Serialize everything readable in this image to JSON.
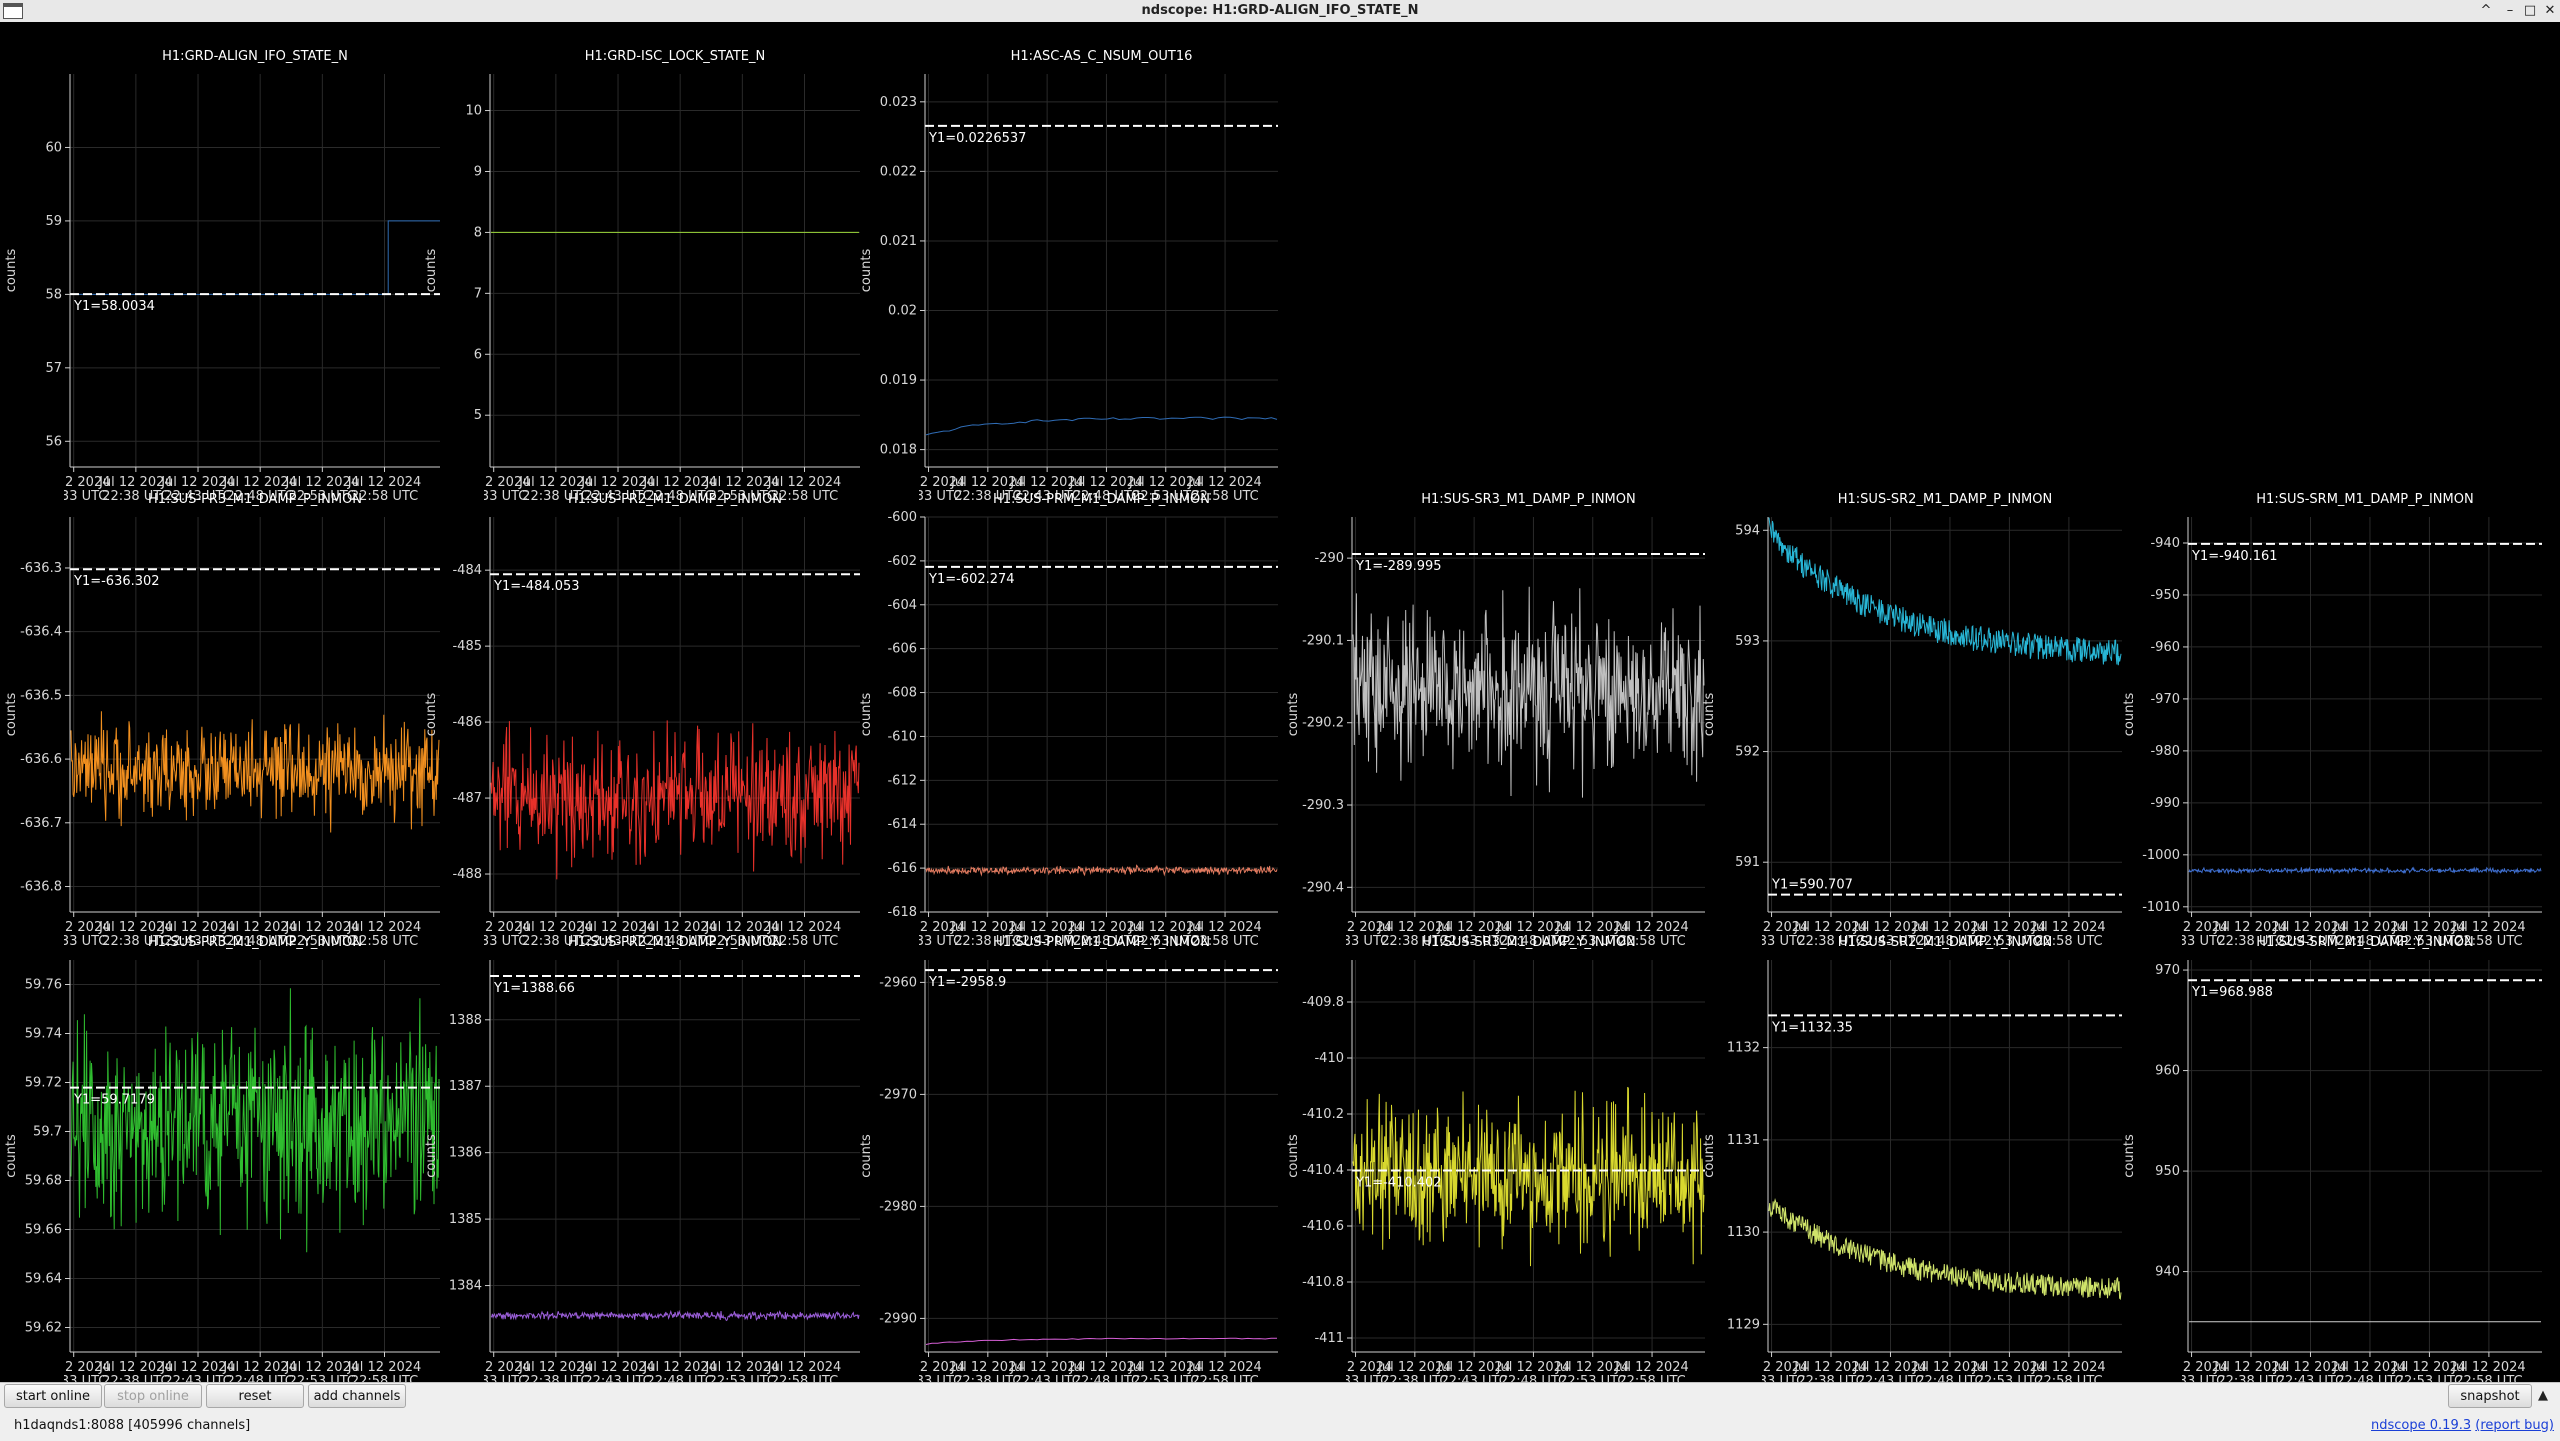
{
  "window": {
    "title": "ndscope: H1:GRD-ALIGN_IFO_STATE_N",
    "controls": [
      "^",
      "–",
      "□",
      "✕"
    ]
  },
  "common": {
    "y_axis_label": "counts",
    "x_ticks": [
      "Jul 12 2024\n22:33 UTC",
      "Jul 12 2024\n22:38 UTC",
      "Jul 12 2024\n22:43 UTC",
      "Jul 12 2024\n22:48 UTC",
      "Jul 12 2024\n22:53 UTC",
      "Jul 12 2024\n22:58 UTC"
    ]
  },
  "plots": [
    {
      "channel": "H1:GRD-ALIGN_IFO_STATE_N",
      "color": "#2f6cb5",
      "cursor_y": 58.0034,
      "cursor_label": "Y1=58.0034",
      "ylim": [
        55.65,
        61.0
      ],
      "yticks": [
        56,
        57,
        58,
        59,
        60
      ],
      "shape": {
        "kind": "step",
        "base": 58.0,
        "step_to": 59.0,
        "at": 0.86
      }
    },
    {
      "channel": "H1:GRD-ISC_LOCK_STATE_N",
      "color": "#9bd83a",
      "cursor_y": null,
      "cursor_label": "",
      "ylim": [
        4.15,
        10.6
      ],
      "yticks": [
        5,
        6,
        7,
        8,
        9,
        10
      ],
      "shape": {
        "kind": "flat",
        "base": 8.0
      }
    },
    {
      "channel": "H1:ASC-AS_C_NSUM_OUT16",
      "color": "#2f6cb5",
      "cursor_y": 0.0226537,
      "cursor_label": "Y1=0.0226537",
      "ylim": [
        0.01775,
        0.0234
      ],
      "yticks": [
        0.018,
        0.019,
        0.02,
        0.021,
        0.022,
        0.023
      ],
      "shape": {
        "kind": "rise",
        "start": 0.0182,
        "end": 0.01845
      }
    },
    {
      "channel": "H1:SUS-PR3_M1_DAMP_P_INMON",
      "color": "#f2901f",
      "cursor_y": -636.302,
      "cursor_label": "Y1=-636.302",
      "ylim": [
        -636.84,
        -636.22
      ],
      "yticks": [
        -636.8,
        -636.7,
        -636.6,
        -636.5,
        -636.4,
        -636.3
      ],
      "shape": {
        "kind": "noise",
        "center": -636.62,
        "amp": 0.05
      }
    },
    {
      "channel": "H1:SUS-PR2_M1_DAMP_P_INMON",
      "color": "#e8312a",
      "cursor_y": -484.053,
      "cursor_label": "Y1=-484.053",
      "ylim": [
        -488.5,
        -483.3
      ],
      "yticks": [
        -488,
        -487,
        -486,
        -485,
        -484
      ],
      "shape": {
        "kind": "noise",
        "center": -486.95,
        "amp": 0.6
      }
    },
    {
      "channel": "H1:SUS-PRM_M1_DAMP_P_INMON",
      "color": "#e07a5f",
      "cursor_y": -602.274,
      "cursor_label": "Y1=-602.274",
      "ylim": [
        -618.0,
        -600.0
      ],
      "yticks": [
        -618,
        -616,
        -614,
        -612,
        -610,
        -608,
        -606,
        -604,
        -602,
        -600
      ],
      "shape": {
        "kind": "noise",
        "center": -616.1,
        "amp": 0.12
      }
    },
    {
      "channel": "H1:SUS-SR3_M1_DAMP_P_INMON",
      "color": "#bfbfbf",
      "cursor_y": -289.995,
      "cursor_label": "Y1=-289.995",
      "ylim": [
        -290.43,
        -289.95
      ],
      "yticks": [
        -290.4,
        -290.3,
        -290.2,
        -290.1,
        -290.0
      ],
      "shape": {
        "kind": "noise",
        "center": -290.16,
        "amp": 0.07
      }
    },
    {
      "channel": "H1:SUS-SR2_M1_DAMP_P_INMON",
      "color": "#28b6d6",
      "cursor_y": 590.707,
      "cursor_label": "Y1=590.707",
      "ylim": [
        590.55,
        594.12
      ],
      "yticks": [
        591,
        592,
        593,
        594
      ],
      "shape": {
        "kind": "decay",
        "start": 594.0,
        "end": 592.85,
        "amp": 0.12
      }
    },
    {
      "channel": "H1:SUS-SRM_M1_DAMP_P_INMON",
      "color": "#3f6fd0",
      "cursor_y": -940.161,
      "cursor_label": "Y1=-940.161",
      "ylim": [
        -1011.0,
        -935.0
      ],
      "yticks": [
        -1010,
        -1000,
        -990,
        -980,
        -970,
        -960,
        -950,
        -940
      ],
      "shape": {
        "kind": "noise",
        "center": -1003.0,
        "amp": 0.3
      }
    },
    {
      "channel": "H1:SUS-PR3_M1_DAMP_Y_INMON",
      "color": "#2fbd2f",
      "cursor_y": 59.7179,
      "cursor_label": "Y1=59.7179",
      "ylim": [
        59.61,
        59.77
      ],
      "yticks": [
        59.62,
        59.64,
        59.66,
        59.68,
        59.7,
        59.72,
        59.74,
        59.76
      ],
      "shape": {
        "kind": "noise",
        "center": 59.705,
        "amp": 0.03
      }
    },
    {
      "channel": "H1:SUS-PR2_M1_DAMP_Y_INMON",
      "color": "#9a5ed8",
      "cursor_y": 1388.66,
      "cursor_label": "Y1=1388.66",
      "ylim": [
        1383.0,
        1388.9
      ],
      "yticks": [
        1384,
        1385,
        1386,
        1387,
        1388
      ],
      "shape": {
        "kind": "noise",
        "center": 1383.55,
        "amp": 0.04
      }
    },
    {
      "channel": "H1:SUS-PRM_M1_DAMP_Y_INMON",
      "color": "#d65fd6",
      "cursor_y": -2958.9,
      "cursor_label": "Y1=-2958.9",
      "ylim": [
        -2993.0,
        -2958.0
      ],
      "yticks": [
        -2990,
        -2980,
        -2970,
        -2960
      ],
      "shape": {
        "kind": "rise",
        "start": -2992.3,
        "end": -2991.8
      }
    },
    {
      "channel": "H1:SUS-SR3_M1_DAMP_Y_INMON",
      "color": "#d8d82e",
      "cursor_y": -410.402,
      "cursor_label": "Y1=-410.402",
      "ylim": [
        -411.05,
        -409.65
      ],
      "yticks": [
        -411,
        -410.8,
        -410.6,
        -410.4,
        -410.2,
        -410,
        -409.8
      ],
      "shape": {
        "kind": "noise",
        "center": -410.42,
        "amp": 0.18
      }
    },
    {
      "channel": "H1:SUS-SR2_M1_DAMP_Y_INMON",
      "color": "#cfe36a",
      "cursor_y": 1132.35,
      "cursor_label": "Y1=1132.35",
      "ylim": [
        1128.7,
        1132.95
      ],
      "yticks": [
        1129,
        1130,
        1131,
        1132
      ],
      "shape": {
        "kind": "decay",
        "start": 1130.3,
        "end": 1129.35,
        "amp": 0.12
      }
    },
    {
      "channel": "H1:SUS-SRM_M1_DAMP_Y_INMON",
      "color": "#cfcfcf",
      "cursor_y": 968.988,
      "cursor_label": "Y1=968.988",
      "ylim": [
        932.0,
        971.0
      ],
      "yticks": [
        940,
        950,
        960,
        970
      ],
      "shape": {
        "kind": "flat",
        "base": 935.0
      }
    }
  ],
  "buttons": {
    "start_online": "start online",
    "stop_online": "stop online",
    "reset": "reset",
    "add_channels": "add channels",
    "snapshot": "snapshot"
  },
  "status": {
    "server": "h1daqnds1:8088",
    "channels": "[405996 channels]",
    "version_link": "ndscope 0.19.3",
    "report_bug": "(report bug)"
  }
}
